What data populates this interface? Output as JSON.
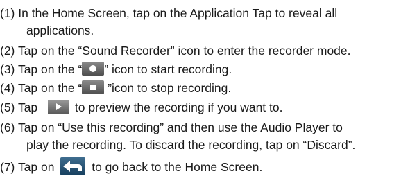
{
  "steps": [
    {
      "num": "(1)",
      "line1": "In the Home Screen, tap on the Application Tap to reveal all",
      "line2": "applications."
    },
    {
      "num": "(2)",
      "text": "Tap on the “Sound Recorder” icon to enter the recorder mode."
    },
    {
      "num": "(3)",
      "before": "Tap on the “",
      "after": "” icon to start recording.",
      "icon": "record-button-icon"
    },
    {
      "num": "(4)",
      "before": "Tap on the “",
      "after": " ”icon to stop recording.",
      "icon": "stop-button-icon"
    },
    {
      "num": "(5)",
      "before": "Tap ",
      "after": " to preview the recording if you want to.",
      "icon": "play-button-icon"
    },
    {
      "num": "(6)",
      "line1": "Tap on “Use this recording” and then use the Audio Player to",
      "line2": "play the recording. To discard the recording, tap on “Discard”."
    },
    {
      "num": "(7)",
      "before": "Tap on ",
      "after": " to go back to the Home Screen.",
      "icon": "back-arrow-icon"
    }
  ]
}
